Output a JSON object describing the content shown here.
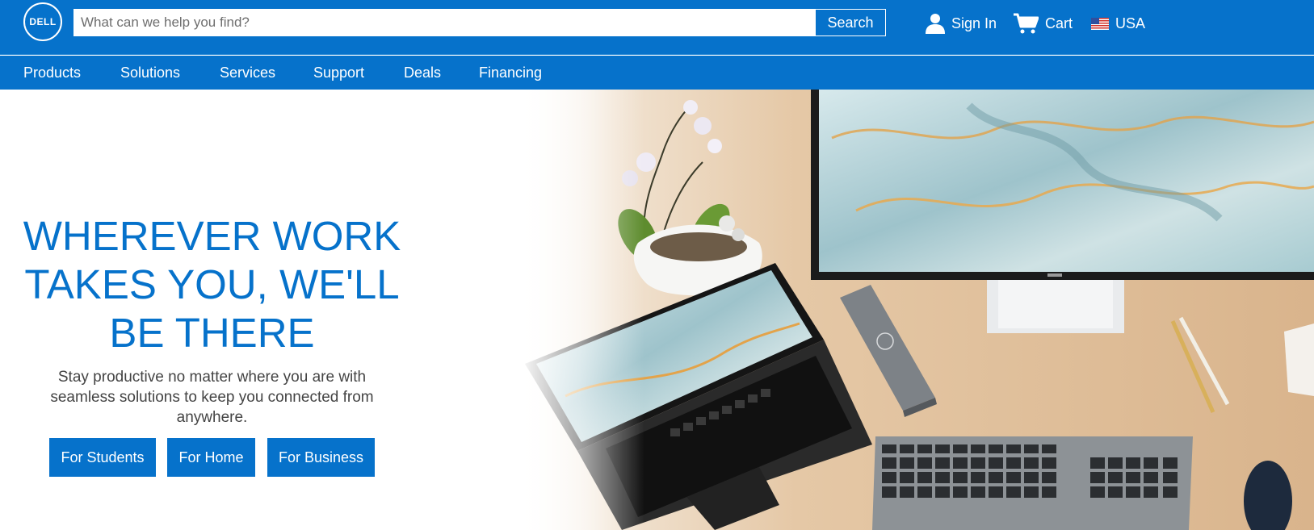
{
  "header": {
    "logo_text": "DELL",
    "search": {
      "placeholder": "What can we help you find?",
      "value": "",
      "button_label": "Search"
    },
    "sign_in_label": "Sign In",
    "cart_label": "Cart",
    "country_label": "USA"
  },
  "nav": {
    "items": [
      {
        "label": "Products"
      },
      {
        "label": "Solutions"
      },
      {
        "label": "Services"
      },
      {
        "label": "Support"
      },
      {
        "label": "Deals"
      },
      {
        "label": "Financing"
      }
    ]
  },
  "hero": {
    "headline_lines": [
      "WHEREVER WORK",
      "TAKES YOU, WE'LL",
      "BE THERE"
    ],
    "subtext": "Stay productive no matter where you are with seamless solutions to keep you connected from anywhere.",
    "buttons": [
      {
        "label": "For Students"
      },
      {
        "label": "For Home"
      },
      {
        "label": "For Business"
      }
    ],
    "image_icons": [
      "desk-photo"
    ]
  },
  "colors": {
    "brand_blue": "#0672cb",
    "text_gray": "#444444",
    "white": "#ffffff"
  },
  "icons": [
    "dell-logo-icon",
    "user-icon",
    "cart-icon",
    "us-flag-icon"
  ]
}
